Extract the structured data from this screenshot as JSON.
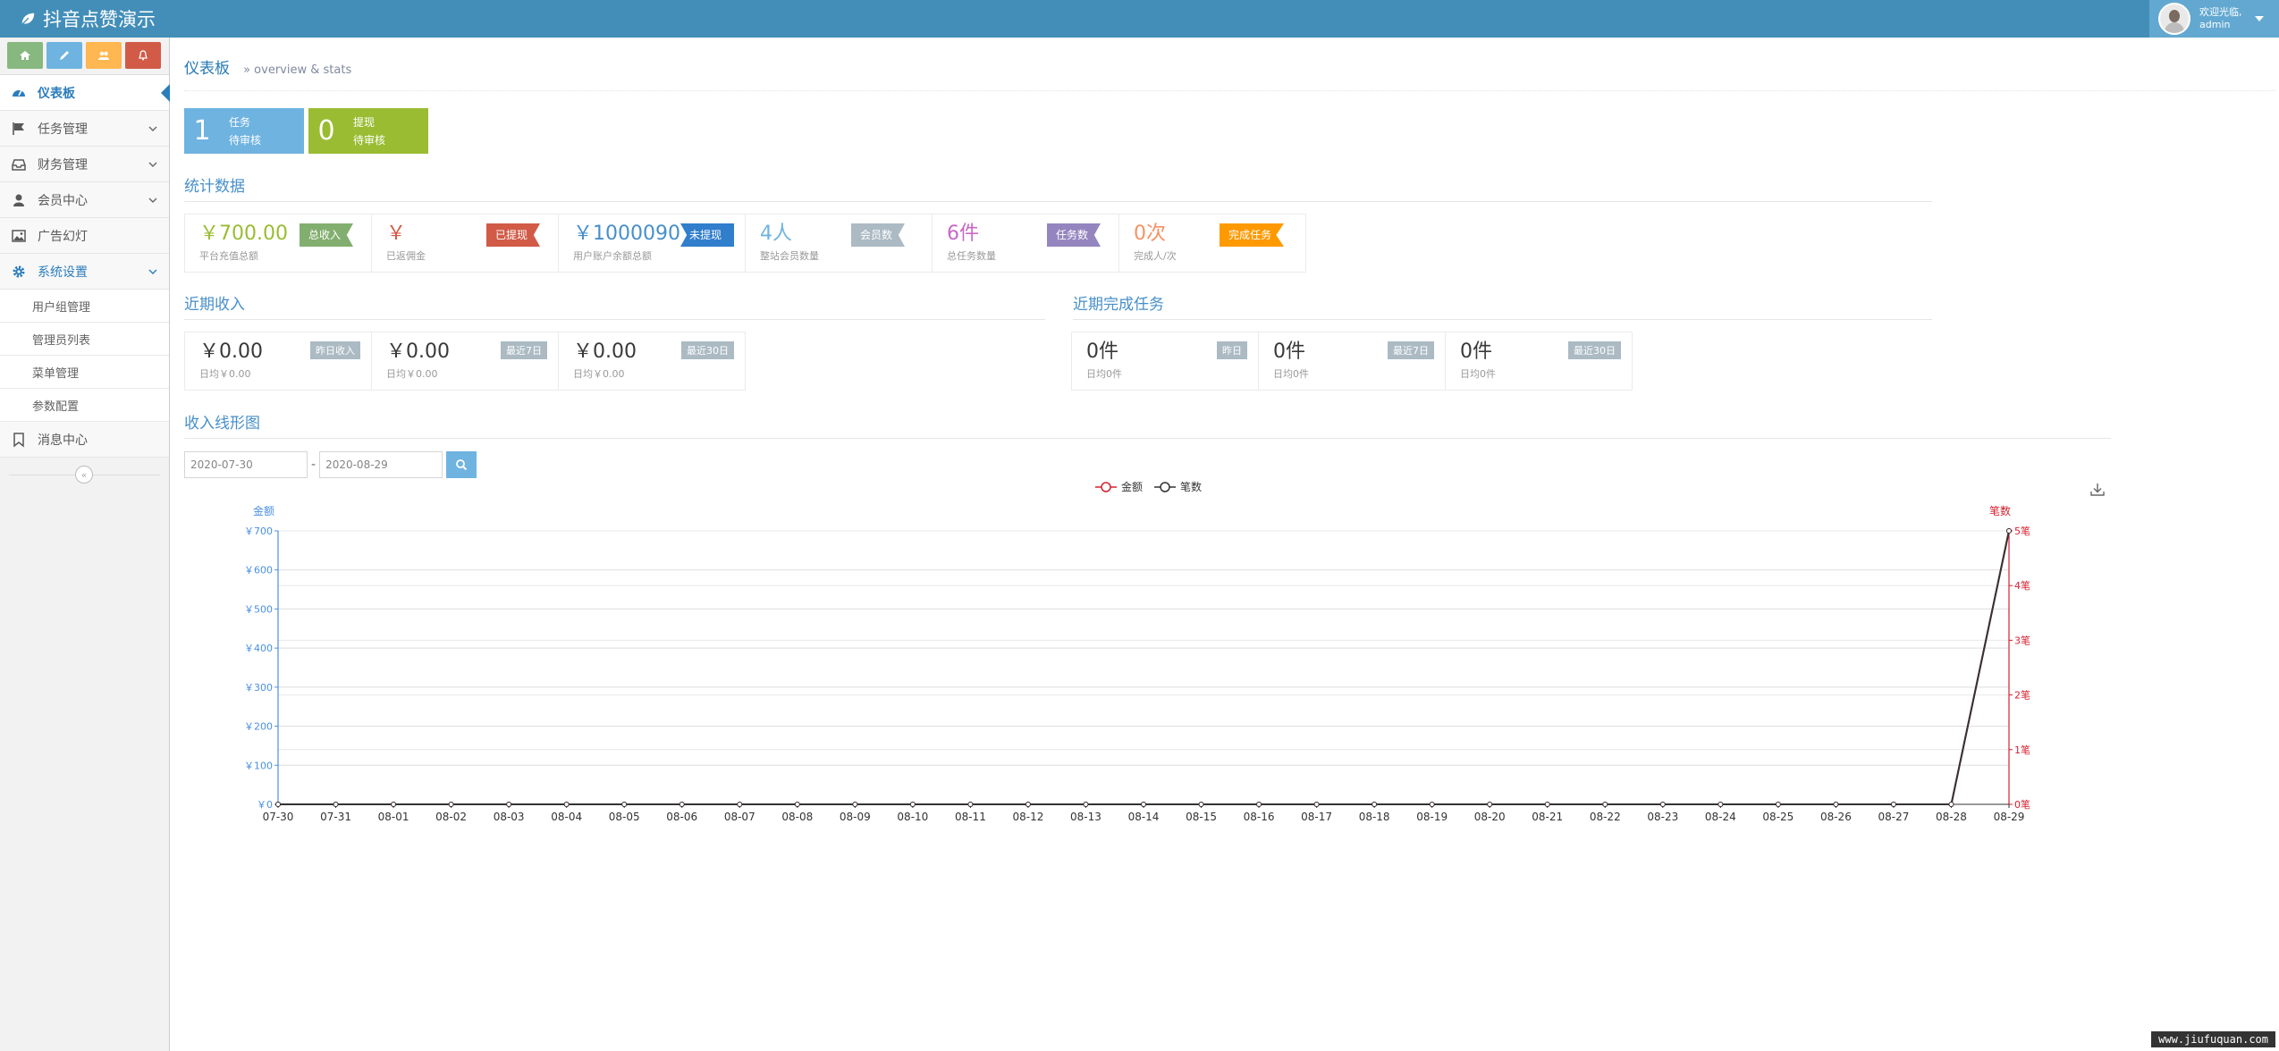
{
  "brand": {
    "title": "抖音点赞演示"
  },
  "user": {
    "greeting": "欢迎光临,",
    "name": "admin"
  },
  "colors": {
    "topbar": "#438eb9",
    "green": "#87b87f",
    "blue": "#6fb3e0",
    "orange": "#ffb752",
    "red": "#d15b47",
    "series_amount": "#d6202f",
    "series_count": "#333333"
  },
  "sidebar": {
    "shortcuts": [
      {
        "icon": "home-icon",
        "color": "#87b87f"
      },
      {
        "icon": "pencil-icon",
        "color": "#6fb3e0"
      },
      {
        "icon": "users-icon",
        "color": "#ffb752"
      },
      {
        "icon": "bell-icon",
        "color": "#d15b47"
      }
    ],
    "items": [
      {
        "label": "仪表板",
        "icon": "dashboard-icon"
      },
      {
        "label": "任务管理",
        "icon": "flag-icon"
      },
      {
        "label": "财务管理",
        "icon": "inbox-icon"
      },
      {
        "label": "会员中心",
        "icon": "user-icon"
      },
      {
        "label": "广告幻灯",
        "icon": "picture-icon"
      },
      {
        "label": "系统设置",
        "icon": "gear-icon"
      },
      {
        "label": "消息中心",
        "icon": "bookmark-icon"
      }
    ],
    "submenu": [
      "用户组管理",
      "管理员列表",
      "菜单管理",
      "参数配置"
    ],
    "collapse": "«"
  },
  "header": {
    "title": "仪表板",
    "subtitle": "» overview & stats"
  },
  "tasks": [
    {
      "num": "1",
      "line1": "任务",
      "line2": "待审核",
      "color": "#6fb3e0"
    },
    {
      "num": "0",
      "line1": "提现",
      "line2": "待审核",
      "color": "#9abc32"
    }
  ],
  "sections": {
    "stats": "统计数据",
    "income": "近期收入",
    "done": "近期完成任务",
    "chart": "收入线形图"
  },
  "stats": [
    {
      "value": "￥700.00",
      "label": "平台充值总额",
      "tag": "总收入",
      "color": "#9abc32",
      "tagcolor": "#82af6f"
    },
    {
      "value": "￥",
      "label": "已返佣金",
      "tag": "已提现",
      "color": "#d15b47",
      "tagcolor": "#d15b47"
    },
    {
      "value": "￥1000090",
      "label": "用户账户余额总额",
      "tag": "未提现",
      "color": "#478fca",
      "tagcolor": "#307ecc"
    },
    {
      "value": "4人",
      "label": "整站会员数量",
      "tag": "会员数",
      "color": "#6fb3e0",
      "tagcolor": "#abbac3"
    },
    {
      "value": "6件",
      "label": "总任务数量",
      "tag": "任务数",
      "color": "#c868c6",
      "tagcolor": "#9585bf"
    },
    {
      "value": "0次",
      "label": "完成人/次",
      "tag": "完成任务",
      "color": "#f79263",
      "tagcolor": "#ff9900"
    }
  ],
  "income": [
    {
      "value": "￥0.00",
      "label": "日均￥0.00",
      "badge": "昨日收入"
    },
    {
      "value": "￥0.00",
      "label": "日均￥0.00",
      "badge": "最近7日"
    },
    {
      "value": "￥0.00",
      "label": "日均￥0.00",
      "badge": "最近30日"
    }
  ],
  "done": [
    {
      "value": "0件",
      "label": "日均0件",
      "badge": "昨日"
    },
    {
      "value": "0件",
      "label": "日均0件",
      "badge": "最近7日"
    },
    {
      "value": "0件",
      "label": "日均0件",
      "badge": "最近30日"
    }
  ],
  "datebar": {
    "from": "2020-07-30",
    "sep": "-",
    "to": "2020-08-29"
  },
  "watermark": "www.jiufuquan.com",
  "chart_data": {
    "type": "line",
    "x": [
      "07-30",
      "07-31",
      "08-01",
      "08-02",
      "08-03",
      "08-04",
      "08-05",
      "08-06",
      "08-07",
      "08-08",
      "08-09",
      "08-10",
      "08-11",
      "08-12",
      "08-13",
      "08-14",
      "08-15",
      "08-16",
      "08-17",
      "08-18",
      "08-19",
      "08-20",
      "08-21",
      "08-22",
      "08-23",
      "08-24",
      "08-25",
      "08-26",
      "08-27",
      "08-28",
      "08-29"
    ],
    "series": [
      {
        "name": "金额",
        "axis": "left",
        "color": "#d6202f",
        "values": [
          0,
          0,
          0,
          0,
          0,
          0,
          0,
          0,
          0,
          0,
          0,
          0,
          0,
          0,
          0,
          0,
          0,
          0,
          0,
          0,
          0,
          0,
          0,
          0,
          0,
          0,
          0,
          0,
          0,
          0,
          700
        ]
      },
      {
        "name": "笔数",
        "axis": "right",
        "color": "#333333",
        "values": [
          0,
          0,
          0,
          0,
          0,
          0,
          0,
          0,
          0,
          0,
          0,
          0,
          0,
          0,
          0,
          0,
          0,
          0,
          0,
          0,
          0,
          0,
          0,
          0,
          0,
          0,
          0,
          0,
          0,
          0,
          5
        ]
      }
    ],
    "ylabel_left": "金额",
    "ylabel_right": "笔数",
    "ylim_left": [
      0,
      700
    ],
    "yticks_left": [
      "￥0",
      "￥100",
      "￥200",
      "￥300",
      "￥400",
      "￥500",
      "￥600",
      "￥700"
    ],
    "ylim_right": [
      0,
      5
    ],
    "yticks_right": [
      "0笔",
      "1笔",
      "2笔",
      "3笔",
      "4笔",
      "5笔"
    ],
    "legend": "top-center",
    "grid": true
  }
}
